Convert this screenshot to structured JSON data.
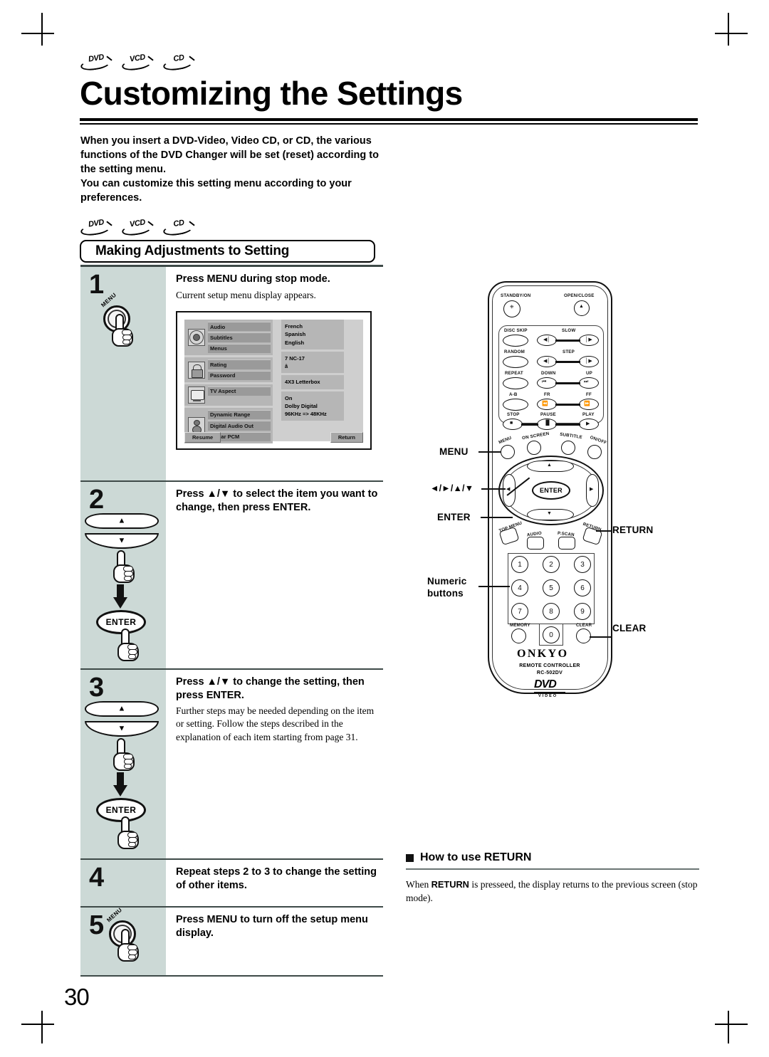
{
  "page": {
    "number": "30",
    "title": "Customizing the Settings",
    "disc_badges": [
      "DVD",
      "VCD",
      "CD"
    ],
    "intro": "When you insert a DVD-Video, Video CD, or CD, the various functions of the DVD Changer will be set (reset) according to the setting menu.\nYou can customize this setting menu according to your preferences."
  },
  "section": {
    "badges": [
      "DVD",
      "VCD",
      "CD"
    ],
    "header": "Making Adjustments to Setting"
  },
  "steps": [
    {
      "number": "1",
      "button_label": "MENU",
      "head": "Press MENU during stop mode.",
      "sub": "Current setup menu display appears."
    },
    {
      "number": "2",
      "head": "Press ▲/▼ to select the item you want to change, then press ENTER.",
      "sub": "",
      "enter_label": "ENTER",
      "up_arrow": "▲",
      "down_arrow": "▼"
    },
    {
      "number": "3",
      "head": "Press ▲/▼ to change the setting, then press ENTER.",
      "sub": "Further steps may be needed depending on the item or setting. Follow the steps described in the explanation of each item starting from page 31.",
      "enter_label": "ENTER",
      "up_arrow": "▲",
      "down_arrow": "▼"
    },
    {
      "number": "4",
      "head": "Repeat steps 2 to 3 to change the setting of other items.",
      "sub": ""
    },
    {
      "number": "5",
      "button_label": "MENU",
      "head": "Press MENU to turn off the setup menu display.",
      "sub": ""
    }
  ],
  "setup_menu": {
    "groups": [
      {
        "icon": "audio-icon",
        "items": [
          "Audio",
          "Subtitles",
          "Menus"
        ]
      },
      {
        "icon": "lock-icon",
        "items": [
          "Rating",
          "Password"
        ]
      },
      {
        "icon": "tv-icon",
        "items": [
          "TV Aspect"
        ]
      },
      {
        "icon": "speaker-icon",
        "items": [
          "Dynamic Range",
          "Digital Audio Out",
          "Linear PCM"
        ]
      }
    ],
    "values": [
      [
        "French",
        "Spanish",
        "English"
      ],
      [
        "7 NC-17",
        "â"
      ],
      [
        "4X3 Letterbox"
      ],
      [
        "On",
        "Dolby Digital",
        "96KHz => 48KHz"
      ]
    ],
    "buttons": {
      "resume": "Resume",
      "return": "Return"
    }
  },
  "remote": {
    "brand": "ONKYO",
    "sub1": "REMOTE CONTROLLER",
    "sub2": "RC-502DV",
    "logo": "DVD",
    "logo_sub": "VIDEO",
    "buttons": {
      "standby": "STANDBY/ON",
      "open_close": "OPEN/CLOSE",
      "disc_skip": "DISC SKIP",
      "slow": "SLOW",
      "random": "RANDOM",
      "step": "STEP",
      "repeat": "REPEAT",
      "down": "DOWN",
      "up": "UP",
      "ab": "A-B",
      "fr": "FR",
      "ff": "FF",
      "stop": "STOP",
      "pause": "PAUSE",
      "play": "PLAY",
      "menu": "MENU",
      "on_screen": "ON SCREEN",
      "subtitle": "SUBTITLE",
      "on_off": "ON/OFF",
      "top_menu": "TOP MENU",
      "audio": "AUDIO",
      "pscan": "P.SCAN",
      "return": "RETURN",
      "memory": "MEMORY",
      "clear": "CLEAR",
      "enter": "ENTER"
    },
    "numeric_keys": [
      "1",
      "2",
      "3",
      "4",
      "5",
      "6",
      "7",
      "8",
      "9",
      "0"
    ],
    "callouts": {
      "menu": "MENU",
      "arrows": "◄/►/▲/▼",
      "enter": "ENTER",
      "return": "RETURN",
      "numeric": "Numeric\nbuttons",
      "numeric_line1": "Numeric",
      "numeric_line2": "buttons",
      "clear": "CLEAR"
    }
  },
  "return_section": {
    "heading": "How to use RETURN",
    "body_pre": "When ",
    "body_bold": "RETURN",
    "body_post": " is presseed, the display returns to the previous screen (stop mode)."
  },
  "colors": {
    "step_column_bg": "#ccd9d6",
    "rule": "#3e4a48",
    "menu_bg": "#cfcfcf"
  }
}
